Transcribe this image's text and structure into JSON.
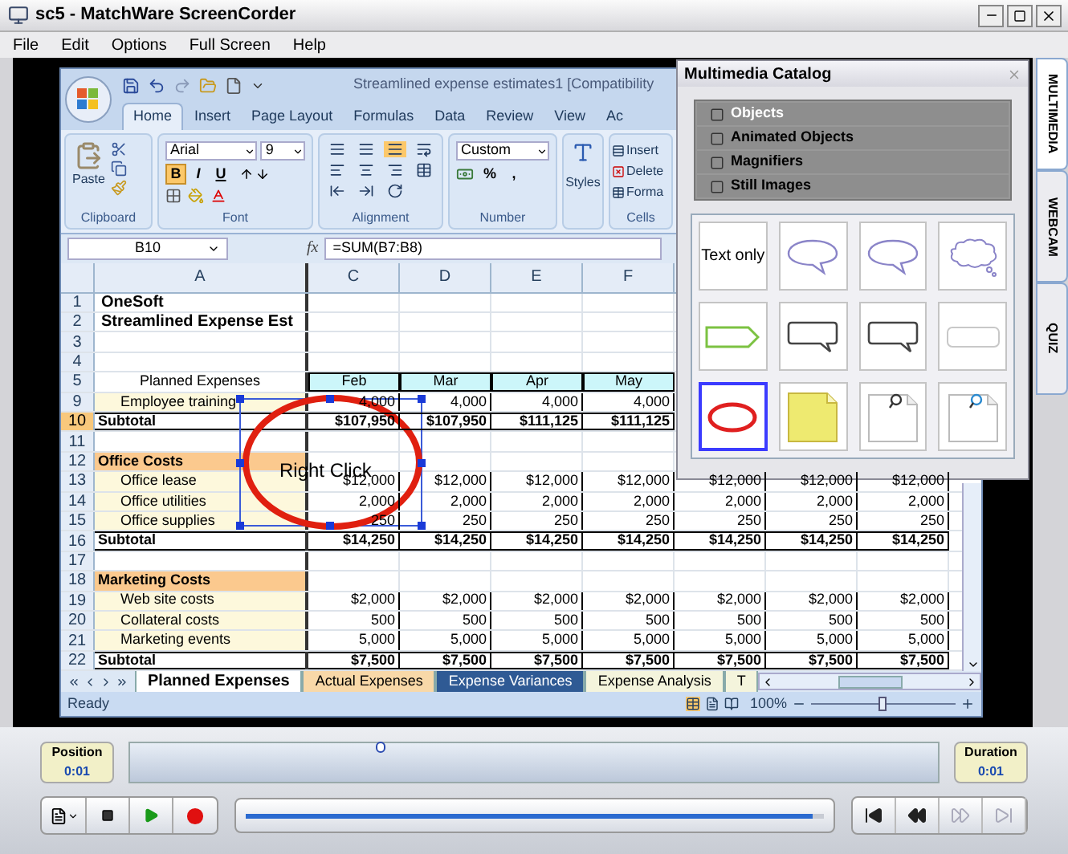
{
  "window": {
    "title": "sc5 - MatchWare ScreenCorder"
  },
  "menu": [
    "File",
    "Edit",
    "Options",
    "Full Screen",
    "Help"
  ],
  "excel": {
    "title": "Streamlined expense estimates1  [Compatibility",
    "tabs": [
      {
        "label": "Home",
        "selected": true
      },
      {
        "label": "Insert",
        "selected": false
      },
      {
        "label": "Page Layout",
        "selected": false
      },
      {
        "label": "Formulas",
        "selected": false
      },
      {
        "label": "Data",
        "selected": false
      },
      {
        "label": "Review",
        "selected": false
      },
      {
        "label": "View",
        "selected": false
      },
      {
        "label": "Ac",
        "selected": false
      }
    ],
    "ribbon": {
      "clipboard": {
        "paste": "Paste",
        "label": "Clipboard"
      },
      "font": {
        "name": "Arial",
        "size": "9",
        "styles": [
          {
            "label": "B",
            "selected": true
          },
          {
            "label": "I",
            "selected": false
          },
          {
            "label": "U",
            "selected": false
          }
        ],
        "label": "Font"
      },
      "alignment": {
        "label": "Alignment"
      },
      "number": {
        "format": "Custom",
        "symbols": [
          "%",
          ","
        ],
        "label": "Number"
      },
      "styles": {
        "label": "Styles"
      },
      "cells": {
        "buttons": [
          "Insert",
          "Delete",
          "Forma"
        ],
        "label": "Cells"
      }
    },
    "name_box": "B10",
    "fx": "fx",
    "formula": "=SUM(B7:B8)",
    "columns": [
      "A",
      "C",
      "D",
      "E",
      "F"
    ],
    "rows": [
      {
        "header": "1",
        "selected": false,
        "kind": "title",
        "label": "OneSoft",
        "cells": []
      },
      {
        "header": "2",
        "selected": false,
        "kind": "title",
        "label": "Streamlined Expense Est",
        "cells": []
      },
      {
        "header": "3",
        "selected": false,
        "kind": "blank",
        "cells": []
      },
      {
        "header": "4",
        "selected": false,
        "kind": "blank",
        "cells": []
      },
      {
        "header": "5",
        "selected": false,
        "kind": "header",
        "label": "Planned Expenses",
        "cells": [
          "Feb",
          "Mar",
          "Apr",
          "May"
        ]
      },
      {
        "header": "9",
        "selected": false,
        "kind": "item",
        "label": "Employee training",
        "cells": [
          "4,000",
          "4,000",
          "4,000",
          "4,000"
        ]
      },
      {
        "header": "10",
        "selected": true,
        "kind": "subtotal",
        "label": "Subtotal",
        "cells": [
          "$107,950",
          "$107,950",
          "$111,125",
          "$111,125"
        ]
      },
      {
        "header": "11",
        "selected": false,
        "kind": "blank",
        "cells": []
      },
      {
        "header": "12",
        "selected": false,
        "kind": "section",
        "label": "Office Costs",
        "cells": []
      },
      {
        "header": "13",
        "selected": false,
        "kind": "item",
        "label": "Office lease",
        "cells": [
          "$12,000",
          "$12,000",
          "$12,000",
          "$12,000",
          "$12,000",
          "$12,000",
          "$12,000"
        ]
      },
      {
        "header": "14",
        "selected": false,
        "kind": "item",
        "label": "Office utilities",
        "cells": [
          "2,000",
          "2,000",
          "2,000",
          "2,000",
          "2,000",
          "2,000",
          "2,000"
        ]
      },
      {
        "header": "15",
        "selected": false,
        "kind": "item",
        "label": "Office supplies",
        "cells": [
          "250",
          "250",
          "250",
          "250",
          "250",
          "250",
          "250"
        ]
      },
      {
        "header": "16",
        "selected": false,
        "kind": "subtotal",
        "label": "Subtotal",
        "cells": [
          "$14,250",
          "$14,250",
          "$14,250",
          "$14,250",
          "$14,250",
          "$14,250",
          "$14,250"
        ]
      },
      {
        "header": "17",
        "selected": false,
        "kind": "blank",
        "cells": []
      },
      {
        "header": "18",
        "selected": false,
        "kind": "section",
        "label": "Marketing Costs",
        "cells": []
      },
      {
        "header": "19",
        "selected": false,
        "kind": "item",
        "label": "Web site costs",
        "cells": [
          "$2,000",
          "$2,000",
          "$2,000",
          "$2,000",
          "$2,000",
          "$2,000",
          "$2,000"
        ]
      },
      {
        "header": "20",
        "selected": false,
        "kind": "item",
        "label": "Collateral costs",
        "cells": [
          "500",
          "500",
          "500",
          "500",
          "500",
          "500",
          "500"
        ]
      },
      {
        "header": "21",
        "selected": false,
        "kind": "item",
        "label": "Marketing events",
        "cells": [
          "5,000",
          "5,000",
          "5,000",
          "5,000",
          "5,000",
          "5,000",
          "5,000"
        ]
      },
      {
        "header": "22",
        "selected": false,
        "kind": "subtotal",
        "label": "Subtotal",
        "cells": [
          "$7,500",
          "$7,500",
          "$7,500",
          "$7,500",
          "$7,500",
          "$7,500",
          "$7,500"
        ]
      }
    ],
    "annotation": {
      "text": "Right Click"
    },
    "sheet_tabs": [
      {
        "label": "Planned Expenses",
        "selected": true,
        "color": "#ffffff"
      },
      {
        "label": "Actual Expenses",
        "selected": false,
        "color": "#f8d8a8"
      },
      {
        "label": "Expense Variances",
        "selected": false,
        "color": "#2f5a94"
      },
      {
        "label": "Expense Analysis",
        "selected": false,
        "color": "#f4f4dc"
      },
      {
        "label": "T",
        "selected": false,
        "color": "#f4f4dc"
      }
    ],
    "status": {
      "text": "Ready",
      "zoom": "100%",
      "level": 0.5
    }
  },
  "catalog": {
    "title": "Multimedia Catalog",
    "categories": [
      {
        "label": "Objects",
        "selected": true
      },
      {
        "label": "Animated Objects",
        "selected": false
      },
      {
        "label": "Magnifiers",
        "selected": false
      },
      {
        "label": "Still Images",
        "selected": false
      }
    ],
    "tiles": [
      {
        "kind": "text",
        "label": "Text only",
        "selected": false
      },
      {
        "kind": "speech-oval",
        "selected": false
      },
      {
        "kind": "speech-oval",
        "selected": false
      },
      {
        "kind": "thought-cloud",
        "selected": false
      },
      {
        "kind": "arrow-box",
        "selected": false
      },
      {
        "kind": "speech-rect",
        "selected": false
      },
      {
        "kind": "speech-rect",
        "selected": false
      },
      {
        "kind": "rounded-rect",
        "selected": false
      },
      {
        "kind": "red-ellipse",
        "selected": true
      },
      {
        "kind": "sticky-note",
        "selected": false
      },
      {
        "kind": "note-magnifier",
        "selected": false
      },
      {
        "kind": "note-magnifier",
        "selected": false
      }
    ]
  },
  "side_tabs": [
    {
      "label": "MULTIMEDIA",
      "selected": true
    },
    {
      "label": "WEBCAM",
      "selected": false
    },
    {
      "label": "QUIZ",
      "selected": false
    }
  ],
  "player": {
    "position": {
      "label": "Position",
      "value": "0:01"
    },
    "timeline": {
      "level": 0.31
    },
    "duration": {
      "label": "Duration",
      "value": "0:01"
    },
    "progress": {
      "level": 0.98
    },
    "transport": [
      {
        "kind": "skip-start",
        "disabled": false
      },
      {
        "kind": "rewind",
        "disabled": false
      },
      {
        "kind": "forward",
        "disabled": true
      },
      {
        "kind": "skip-end",
        "disabled": true
      }
    ]
  }
}
